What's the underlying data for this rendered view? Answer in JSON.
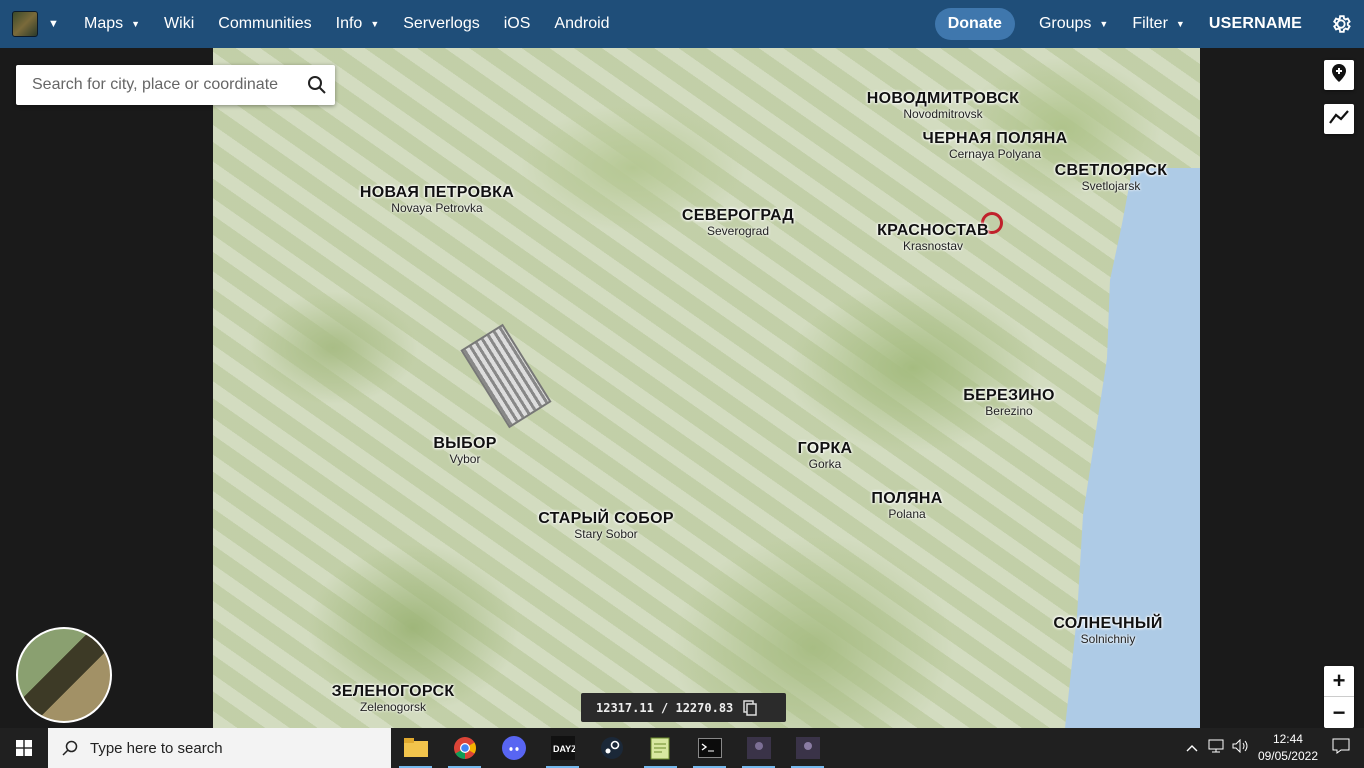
{
  "navbar": {
    "items": [
      {
        "label": "Maps",
        "dropdown": true
      },
      {
        "label": "Wiki",
        "dropdown": false
      },
      {
        "label": "Communities",
        "dropdown": false
      },
      {
        "label": "Info",
        "dropdown": true
      },
      {
        "label": "Serverlogs",
        "dropdown": false
      },
      {
        "label": "iOS",
        "dropdown": false
      },
      {
        "label": "Android",
        "dropdown": false
      }
    ],
    "donate_label": "Donate",
    "groups_label": "Groups",
    "filter_label": "Filter",
    "username": "USERNAME",
    "brand_color": "#1f4e79"
  },
  "search": {
    "placeholder": "Search for city, place or coordinate",
    "value": ""
  },
  "map": {
    "cities": [
      {
        "ru": "НОВОДМИТРОВСК",
        "lat": "Novodmitrovsk"
      },
      {
        "ru": "ЧЕРНАЯ ПОЛЯНА",
        "lat": "Cernaya Polyana"
      },
      {
        "ru": "СВЕТЛОЯРСК",
        "lat": "Svetlojarsk"
      },
      {
        "ru": "НОВАЯ ПЕТРОВКА",
        "lat": "Novaya Petrovka"
      },
      {
        "ru": "СЕВЕРОГРАД",
        "lat": "Severograd"
      },
      {
        "ru": "КРАСНОСТАВ",
        "lat": "Krasnostav"
      },
      {
        "ru": "БЕРЕЗИНО",
        "lat": "Berezino"
      },
      {
        "ru": "ВЫБОР",
        "lat": "Vybor"
      },
      {
        "ru": "ГОРКА",
        "lat": "Gorka"
      },
      {
        "ru": "ПОЛЯНА",
        "lat": "Polana"
      },
      {
        "ru": "СТАРЫЙ СОБОР",
        "lat": "Stary Sobor"
      },
      {
        "ru": "СОЛНЕЧНЫЙ",
        "lat": "Solnichniy"
      },
      {
        "ru": "ЗЕЛЕНОГОРСК",
        "lat": "Zelenogorsk"
      }
    ],
    "coordinates": "12317.11 / 12270.83",
    "zoom_in": "+",
    "zoom_out": "−"
  },
  "taskbar": {
    "search_placeholder": "Type here to search",
    "time": "12:44",
    "date": "09/05/2022",
    "apps": [
      "file-explorer",
      "chrome",
      "discord",
      "dayz",
      "steam",
      "notepad",
      "terminal",
      "game-1",
      "game-2"
    ]
  }
}
